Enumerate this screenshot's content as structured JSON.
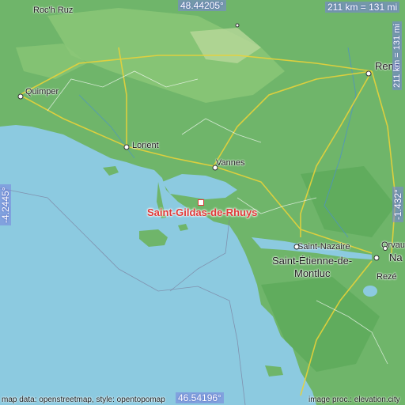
{
  "map": {
    "target_city": "Saint-Gildas-de-Rhuys",
    "marker_color": "#e03a3a",
    "land_color": "#6fb56a",
    "sea_color": "#8ccae0",
    "cities": [
      {
        "id": "rochruz",
        "name": "Roc'h Ruz"
      },
      {
        "id": "quimper",
        "name": "Quimper"
      },
      {
        "id": "lorient",
        "name": "Lorient"
      },
      {
        "id": "vannes",
        "name": "Vannes"
      },
      {
        "id": "rennes",
        "name": "Renn"
      },
      {
        "id": "saintnazaire",
        "name": "Saint-Nazaire"
      },
      {
        "id": "sainteetienne1",
        "name": "Saint-Étienne-de-"
      },
      {
        "id": "sainteetienne2",
        "name": "Montluc"
      },
      {
        "id": "orvault",
        "name": "Orvau"
      },
      {
        "id": "nantes",
        "name": "Na"
      },
      {
        "id": "reze",
        "name": "Rezé"
      }
    ],
    "coords": {
      "top": "48.44205°",
      "bottom": "46.54196°",
      "left": "-4.2445°",
      "right": "-1.432°"
    },
    "scale": "211 km = 131 mi",
    "footer_left": "map data: openstreetmap, style: opentopomap",
    "footer_right": "image proc.: elevation.city"
  }
}
